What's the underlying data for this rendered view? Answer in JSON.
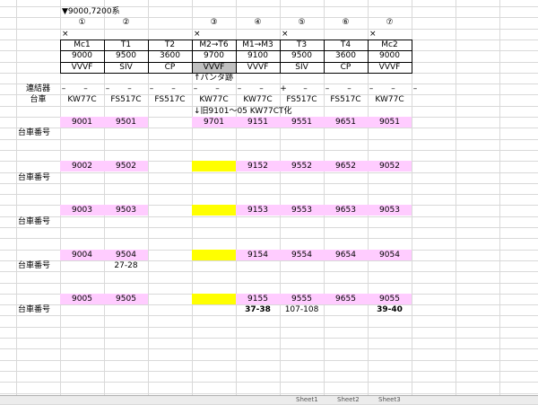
{
  "title": "▼9000,7200系",
  "car_numbers": [
    "①",
    "②",
    "",
    "③",
    "④",
    "⑤",
    "⑥",
    "⑦"
  ],
  "coupling_marks": [
    "×",
    "",
    "",
    "×",
    "",
    "×",
    "",
    "×"
  ],
  "types": [
    "Mc1",
    "T1",
    "T2",
    "M2→T6",
    "M1→M3",
    "T3",
    "T4",
    "Mc2"
  ],
  "series": [
    "9000",
    "9500",
    "3600",
    "9700",
    "9100",
    "9500",
    "3600",
    "9000"
  ],
  "equipment": [
    "VVVF",
    "SIV",
    "CP",
    "VVVF",
    "VVVF",
    "SIV",
    "CP",
    "VVVF"
  ],
  "pantograph_note": "↑パンタ跡",
  "coupler_label": "連結器",
  "coupler_marks": [
    "–",
    "–",
    "–",
    "–",
    "–",
    "–",
    "–",
    "–",
    "–",
    "–",
    "+",
    "–",
    "–",
    "–",
    "–",
    "–",
    "–"
  ],
  "bogie_label": "台車",
  "bogies": [
    "KW77C",
    "FS517C",
    "FS517C",
    "KW77C",
    "KW77C",
    "FS517C",
    "FS517C",
    "KW77C"
  ],
  "old_note": "↓旧9101～05 KW77CT化",
  "bogie_number_label": "台車番号",
  "rows": [
    {
      "cars": [
        "9001",
        "9501",
        "",
        "9701",
        "9151",
        "9551",
        "9651",
        "9051"
      ],
      "bogie_no": [
        "",
        "",
        "",
        "",
        "",
        "",
        "",
        ""
      ]
    },
    {
      "cars": [
        "9002",
        "9502",
        "",
        "",
        "9152",
        "9552",
        "9652",
        "9052"
      ],
      "bogie_no": [
        "",
        "",
        "",
        "",
        "",
        "",
        "",
        ""
      ]
    },
    {
      "cars": [
        "9003",
        "9503",
        "",
        "",
        "9153",
        "9553",
        "9653",
        "9053"
      ],
      "bogie_no": [
        "",
        "",
        "",
        "",
        "",
        "",
        "",
        ""
      ]
    },
    {
      "cars": [
        "9004",
        "9504",
        "",
        "",
        "9154",
        "9554",
        "9654",
        "9054"
      ],
      "bogie_no": [
        "",
        "27-28",
        "",
        "",
        "",
        "",
        "",
        ""
      ]
    },
    {
      "cars": [
        "9005",
        "9505",
        "",
        "",
        "9155",
        "9555",
        "9655",
        "9055"
      ],
      "bogie_no": [
        "",
        "",
        "",
        "",
        "37-38",
        "107-108",
        "",
        "39-40"
      ]
    }
  ],
  "colors": {
    "pink": "#ffccff",
    "yellow": "#ffff00",
    "gray": "#c0c0c0"
  },
  "sheet_tabs": [
    "Sheet1",
    "Sheet2",
    "Sheet3"
  ]
}
